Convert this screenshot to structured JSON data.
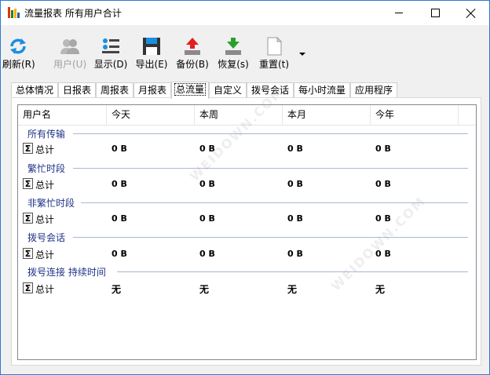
{
  "window": {
    "title": "流量报表 所有用户合计"
  },
  "toolbar": {
    "refresh_label": "刷新(R)",
    "users_label": "用户(U)",
    "display_label": "显示(D)",
    "export_label": "导出(E)",
    "backup_label": "备份(B)",
    "restore_label": "恢复(s)",
    "reset_label": "重置(t)"
  },
  "tabs": [
    {
      "label": "总体情况"
    },
    {
      "label": "日报表"
    },
    {
      "label": "周报表"
    },
    {
      "label": "月报表"
    },
    {
      "label": "总流量"
    },
    {
      "label": "自定义"
    },
    {
      "label": "拨号会话"
    },
    {
      "label": "每小时流量"
    },
    {
      "label": "应用程序"
    }
  ],
  "active_tab": "总流量",
  "table": {
    "columns": [
      "用户名",
      "今天",
      "本周",
      "本月",
      "今年"
    ],
    "sigma_symbol": "Σ",
    "groups": [
      {
        "title": "所有传输",
        "row_label": "总计",
        "values": [
          "0 B",
          "0 B",
          "0 B",
          "0 B"
        ]
      },
      {
        "title": "繁忙时段",
        "row_label": "总计",
        "values": [
          "0 B",
          "0 B",
          "0 B",
          "0 B"
        ]
      },
      {
        "title": "非繁忙时段",
        "row_label": "总计",
        "values": [
          "0 B",
          "0 B",
          "0 B",
          "0 B"
        ]
      },
      {
        "title": "拨号会话",
        "row_label": "总计",
        "values": [
          "0 B",
          "0 B",
          "0 B",
          "0 B"
        ]
      },
      {
        "title": "拨号连接 持续时间",
        "row_label": "总计",
        "values": [
          "无",
          "无",
          "无",
          "无"
        ]
      }
    ]
  },
  "watermark": "WEIDOWN.COM",
  "colors": {
    "group_title": "#1e3287",
    "window_border": "#2b79d6",
    "refresh_icon": "#1a8fe0",
    "backup_arrow": "#e02020",
    "restore_arrow": "#2aa02a"
  }
}
